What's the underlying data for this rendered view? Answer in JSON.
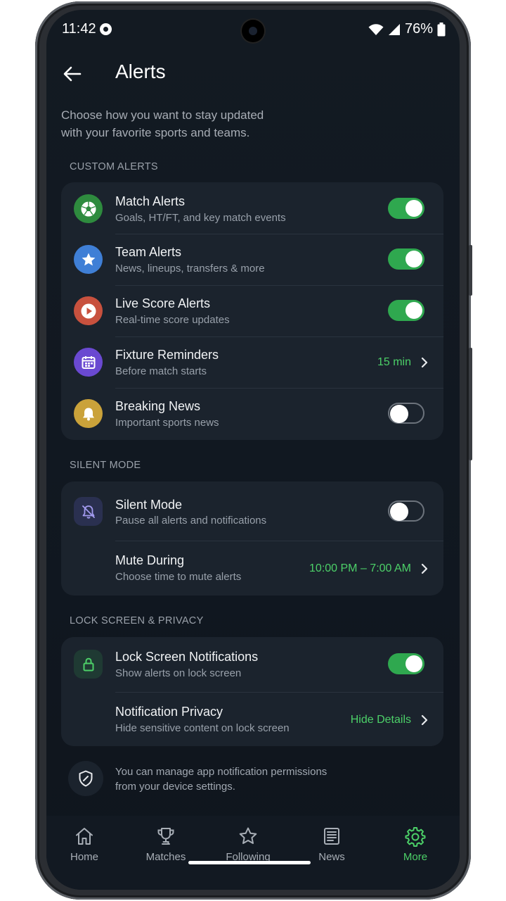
{
  "status_bar": {
    "time": "11:42",
    "battery": "76%"
  },
  "header": {
    "title": "Alerts"
  },
  "intro": {
    "line1": "Choose how you want to stay updated",
    "line2": "with your favorite sports and teams."
  },
  "sections": {
    "custom": {
      "label": "CUSTOM ALERTS",
      "items": [
        {
          "title": "Match Alerts",
          "subtitle": "Goals, HT/FT, and key match events",
          "icon": "soccer-ball-icon",
          "color": "#2e8b3e",
          "toggle": true
        },
        {
          "title": "Team Alerts",
          "subtitle": "News, lineups, transfers & more",
          "icon": "star-icon",
          "color": "#3f7fd6",
          "toggle": true
        },
        {
          "title": "Live Score Alerts",
          "subtitle": "Real-time score updates",
          "icon": "play-icon",
          "color": "#c8513e",
          "toggle": true
        },
        {
          "title": "Fixture Reminders",
          "subtitle": "Before match starts",
          "icon": "calendar-icon",
          "color": "#6a49d1",
          "value": "15 min"
        },
        {
          "title": "Breaking News",
          "subtitle": "Important sports news",
          "icon": "bell-icon",
          "color": "#caa23a",
          "toggle": false
        }
      ]
    },
    "silent": {
      "label": "SILENT MODE",
      "items": [
        {
          "title": "Silent Mode",
          "subtitle": "Pause all alerts and notifications",
          "icon": "bell-off-icon",
          "toggle": false
        },
        {
          "title": "Mute During",
          "subtitle": "Choose time to mute alerts",
          "value": "10:00 PM – 7:00 AM"
        }
      ]
    },
    "lock": {
      "label": "LOCK SCREEN & PRIVACY",
      "items": [
        {
          "title": "Lock Screen Notifications",
          "subtitle": "Show alerts on lock screen",
          "icon": "lock-icon",
          "toggle": true
        },
        {
          "title": "Notification Privacy",
          "subtitle": "Hide sensitive content on lock screen",
          "value": "Hide Details"
        }
      ]
    }
  },
  "footnote": {
    "line1": "You can manage app notification permissions",
    "line2": "from your device settings."
  },
  "nav": [
    {
      "label": "Home",
      "icon": "home-icon",
      "active": false
    },
    {
      "label": "Matches",
      "icon": "trophy-icon",
      "active": false
    },
    {
      "label": "Following",
      "icon": "star-outline-icon",
      "active": false
    },
    {
      "label": "News",
      "icon": "newspaper-icon",
      "active": false
    },
    {
      "label": "More",
      "icon": "gear-icon",
      "active": true
    }
  ],
  "colors": {
    "accent": "#4cd068",
    "toggle_on": "#2fa84f",
    "background": "#131a22",
    "card": "#1b232d"
  }
}
